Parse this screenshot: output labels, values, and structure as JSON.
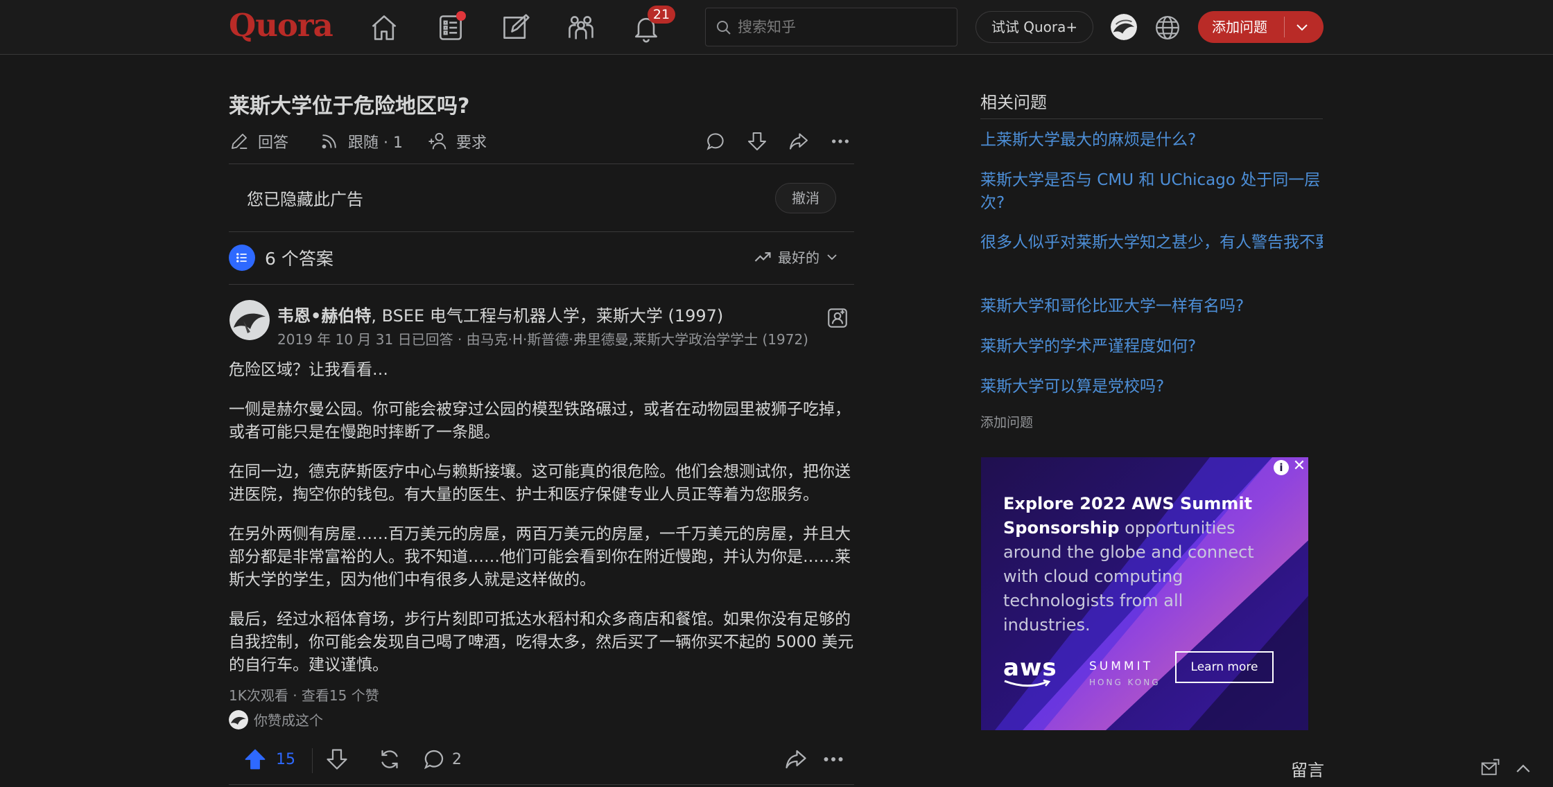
{
  "header": {
    "logo": "Quora",
    "notification_count": "21",
    "search_placeholder": "搜索知乎",
    "try_plus": "试试 Quora+",
    "add_question": "添加问题",
    "nav_icons": [
      "home-icon",
      "following-icon",
      "answer-icon",
      "spaces-icon",
      "bell-icon"
    ],
    "brand_color": "#b92b27"
  },
  "question": {
    "title": "莱斯大学位于危险地区吗?",
    "answer_label": "回答",
    "follow_label": "跟随 · 1",
    "request_label": "要求"
  },
  "ad_hidden": {
    "text": "您已隐藏此广告",
    "undo": "撤消"
  },
  "answers_header": {
    "count_label": "6 个答案",
    "sort_label": "最好的"
  },
  "answer": {
    "author": "韦恩•赫伯特",
    "credential": ", BSEE 电气工程与机器人学，莱斯大学 (1997)",
    "meta": "2019 年 10 月 31 日已回答 · 由马克·H·斯普德·弗里德曼,莱斯大学政治学学士 (1972)",
    "paragraphs": [
      "危险区域？让我看看…",
      "一侧是赫尔曼公园。你可能会被穿过公园的模型铁路碾过，或者在动物园里被狮子吃掉，或者可能只是在慢跑时摔断了一条腿。",
      "在同一边，德克萨斯医疗中心与赖斯接壤。这可能真的很危险。他们会想测试你，把你送进医院，掏空你的钱包。有大量的医生、护士和医疗保健专业人员正等着为您服务。",
      "在另外两侧有房屋……百万美元的房屋，两百万美元的房屋，一千万美元的房屋，并且大部分都是非常富裕的人。我不知道……他们可能会看到你在附近慢跑，并认为你是……莱斯大学的学生，因为他们中有很多人就是这样做的。",
      "最后，经过水稻体育场，步行片刻即可抵达水稻村和众多商店和餐馆。如果你没有足够的自我控制，你可能会发现自己喝了啤酒，吃得太多，然后买了一辆你买不起的 5000 美元的自行车。建议谨慎。"
    ],
    "stats": "1K次观看 · 查看15 个赞",
    "upvoted_by_you": "你赞成这个",
    "upvotes": "15",
    "comments": "2",
    "upvote_color": "#2e69ff"
  },
  "sidebar": {
    "related_title": "相关问题",
    "related": [
      "上莱斯大学最大的麻烦是什么?",
      "莱斯大学是否与 CMU 和 UChicago 处于同一层次?",
      "很多人似乎对莱斯大学知之甚少，有人警告我不要去一所“没人知道”的大学。赖斯有多出名...",
      "莱斯大学和哥伦比亚大学一样有名吗?",
      "莱斯大学的学术严谨程度如何?",
      "莱斯大学可以算是党校吗?"
    ],
    "add_question": "添加问题",
    "link_color": "#4d8fd8"
  },
  "ad": {
    "headline_bold": "Explore 2022 AWS Summit Sponsorship",
    "headline_rest": " opportunities around the globe and connect with cloud computing technologists from all industries.",
    "brand": "aws",
    "summit": "SUMMIT",
    "location": "HONG KONG",
    "cta": "Learn more"
  },
  "footer": {
    "message_label": "留言"
  }
}
